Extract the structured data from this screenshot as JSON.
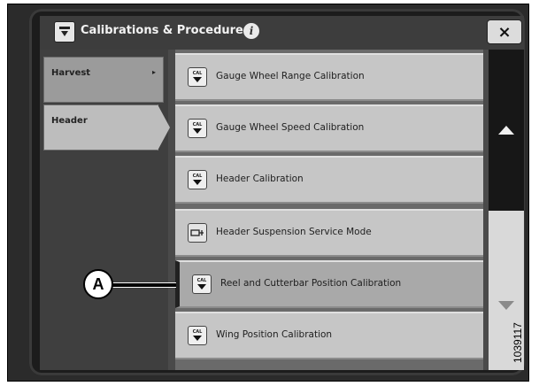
{
  "window": {
    "title": "Calibrations & Procedures",
    "info_icon_glyph": "i",
    "close_glyph": "×"
  },
  "sidebar": {
    "items": [
      {
        "label": "Harvest",
        "arrow": "▸",
        "selected": false
      },
      {
        "label": "Header",
        "arrow": "",
        "selected": true
      }
    ]
  },
  "list": {
    "items": [
      {
        "label": "Gauge Wheel Range Calibration",
        "icon": "calibration-icon",
        "icon_text": "CAL"
      },
      {
        "label": "Gauge Wheel Speed Calibration",
        "icon": "calibration-icon",
        "icon_text": "CAL"
      },
      {
        "label": "Header Calibration",
        "icon": "calibration-icon",
        "icon_text": "CAL"
      },
      {
        "label": "Header Suspension Service Mode",
        "icon": "service-icon",
        "icon_text": ""
      },
      {
        "label": "Reel and Cutterbar Position Calibration",
        "icon": "calibration-icon",
        "icon_text": "CAL",
        "active": true
      },
      {
        "label": "Wing Position Calibration",
        "icon": "calibration-icon",
        "icon_text": "CAL"
      }
    ]
  },
  "scrollbar": {
    "up_icon": "scroll-up-icon",
    "down_icon": "scroll-down-icon"
  },
  "annotation": {
    "callout_letter": "A",
    "figure_number": "1039117"
  },
  "colors": {
    "screen_bg": "#4a4a4a",
    "list_item_bg": "#c6c6c6",
    "selected_sidebar_bg": "#bdbdbd"
  }
}
